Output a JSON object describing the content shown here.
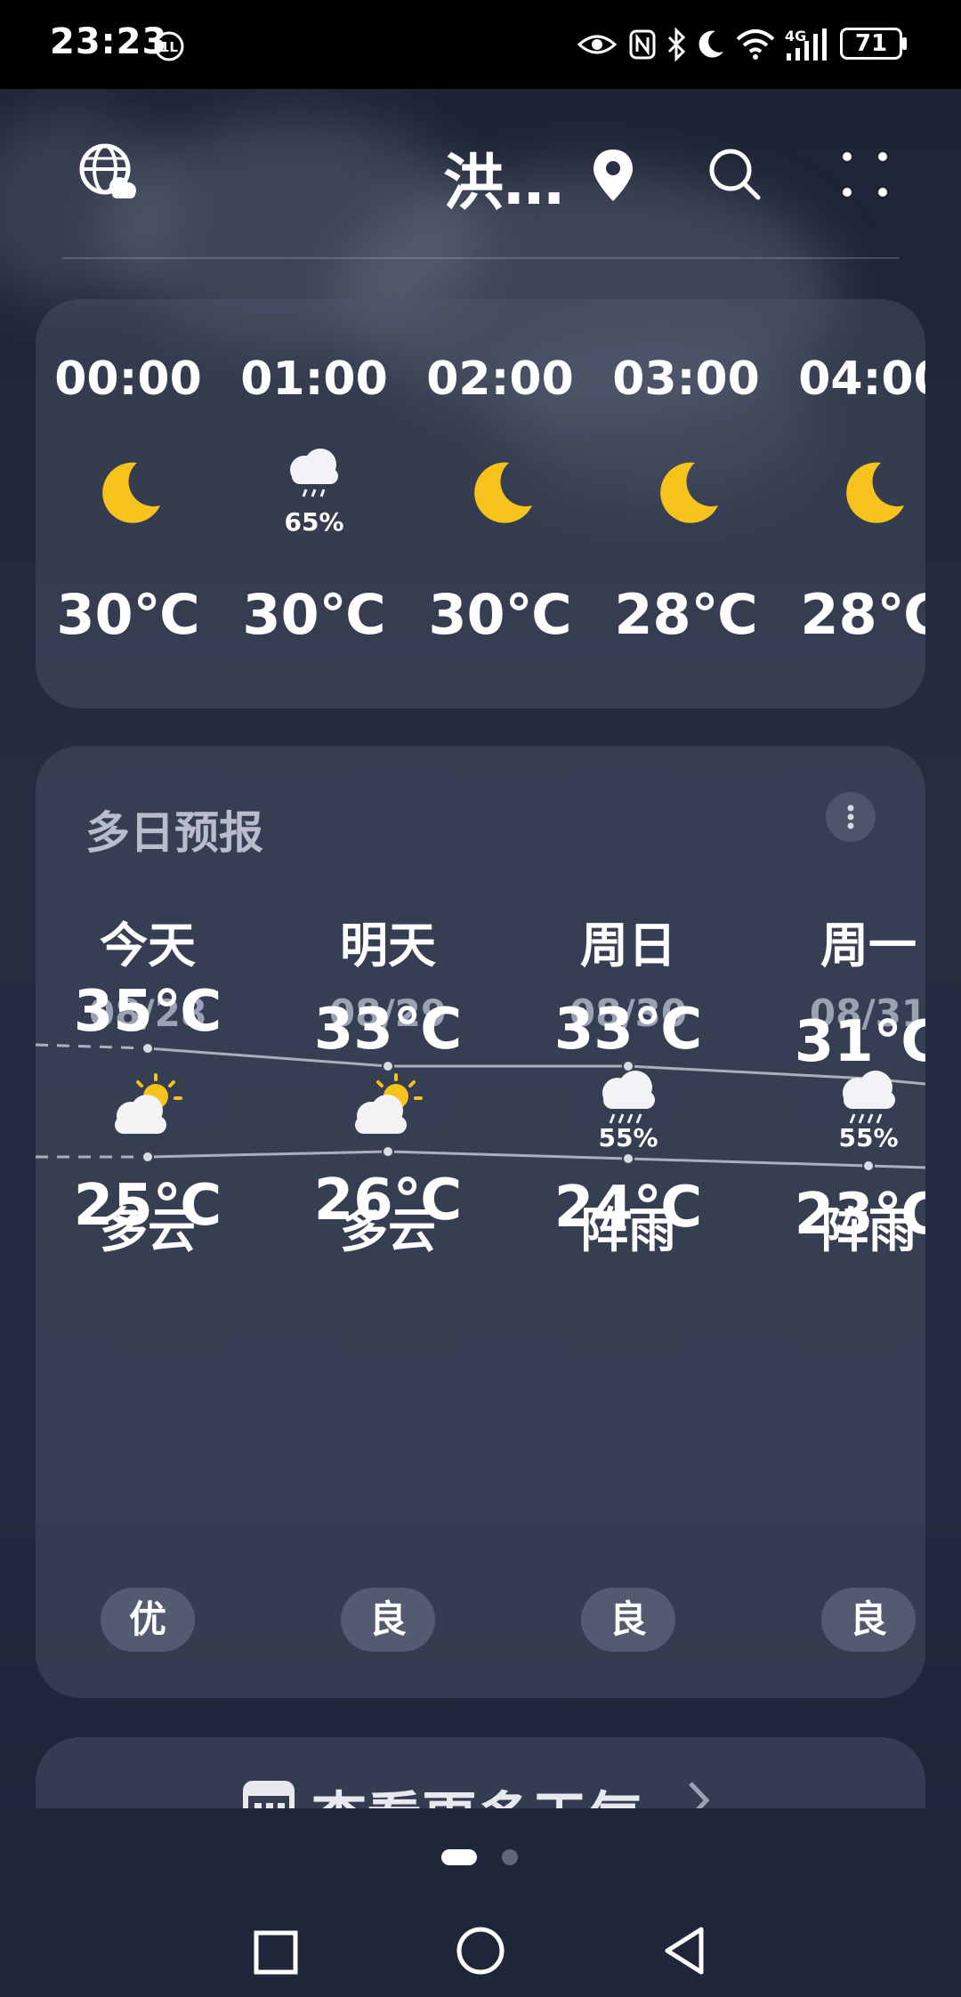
{
  "status_bar": {
    "time": "23:23",
    "battery": "71"
  },
  "header": {
    "city": "洪…"
  },
  "hourly": [
    {
      "time": "00:00",
      "icon": "moon-icon",
      "precip": "",
      "temp": "30℃"
    },
    {
      "time": "01:00",
      "icon": "rain-icon",
      "precip": "65%",
      "temp": "30℃"
    },
    {
      "time": "02:00",
      "icon": "moon-icon",
      "precip": "",
      "temp": "30℃"
    },
    {
      "time": "03:00",
      "icon": "moon-icon",
      "precip": "",
      "temp": "28℃"
    },
    {
      "time": "04:00",
      "icon": "moon-icon",
      "precip": "",
      "temp": "28℃"
    }
  ],
  "daily": {
    "title": "多日预报",
    "days": [
      {
        "name": "今天",
        "date": "08/28",
        "icon": "partly-cloudy-icon",
        "precip": "",
        "cond": "多云",
        "high": "35℃",
        "low": "25℃",
        "aqi": "优"
      },
      {
        "name": "明天",
        "date": "08/29",
        "icon": "partly-cloudy-icon",
        "precip": "",
        "cond": "多云",
        "high": "33℃",
        "low": "26℃",
        "aqi": "良"
      },
      {
        "name": "周日",
        "date": "08/30",
        "icon": "shower-icon",
        "precip": "55%",
        "cond": "阵雨",
        "high": "33℃",
        "low": "24℃",
        "aqi": "良"
      },
      {
        "name": "周一",
        "date": "08/31",
        "icon": "shower-icon",
        "precip": "55%",
        "cond": "阵雨",
        "high": "31℃",
        "low": "23℃",
        "aqi": "良"
      }
    ]
  },
  "more_button": {
    "label": "查看更多天气"
  },
  "pager": {
    "count": 2,
    "active": 1
  },
  "colors": {
    "accent_moon": "#f6c21c",
    "sun": "#f6c21c"
  }
}
